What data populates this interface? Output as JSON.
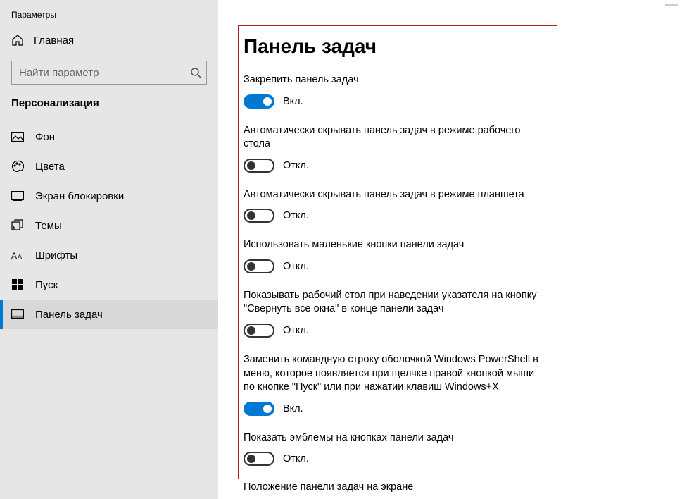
{
  "window": {
    "title": "Параметры"
  },
  "nav": {
    "home": "Главная",
    "search_placeholder": "Найти параметр",
    "category": "Персонализация",
    "items": [
      {
        "label": "Фон",
        "icon": "picture-icon"
      },
      {
        "label": "Цвета",
        "icon": "palette-icon"
      },
      {
        "label": "Экран блокировки",
        "icon": "lock-screen-icon"
      },
      {
        "label": "Темы",
        "icon": "themes-icon"
      },
      {
        "label": "Шрифты",
        "icon": "fonts-icon"
      },
      {
        "label": "Пуск",
        "icon": "start-icon"
      },
      {
        "label": "Панель задач",
        "icon": "taskbar-icon"
      }
    ]
  },
  "main": {
    "title": "Панель задач",
    "toggle_on_label": "Вкл.",
    "toggle_off_label": "Откл.",
    "settings": [
      {
        "label": "Закрепить панель задач",
        "value": true
      },
      {
        "label": "Автоматически скрывать панель задач в режиме рабочего стола",
        "value": false
      },
      {
        "label": "Автоматически скрывать панель задач в режиме планшета",
        "value": false
      },
      {
        "label": "Использовать маленькие кнопки панели задач",
        "value": false
      },
      {
        "label": "Показывать рабочий стол при наведении указателя на кнопку \"Свернуть все окна\" в конце панели задач",
        "value": false
      },
      {
        "label": "Заменить командную строку оболочкой Windows PowerShell в меню, которое появляется при щелчке правой кнопкой мыши по кнопке \"Пуск\" или при нажатии клавиш Windows+X",
        "value": true
      },
      {
        "label": "Показать эмблемы на кнопках панели задач",
        "value": false
      }
    ],
    "next_section": "Положение панели задач на экране"
  }
}
